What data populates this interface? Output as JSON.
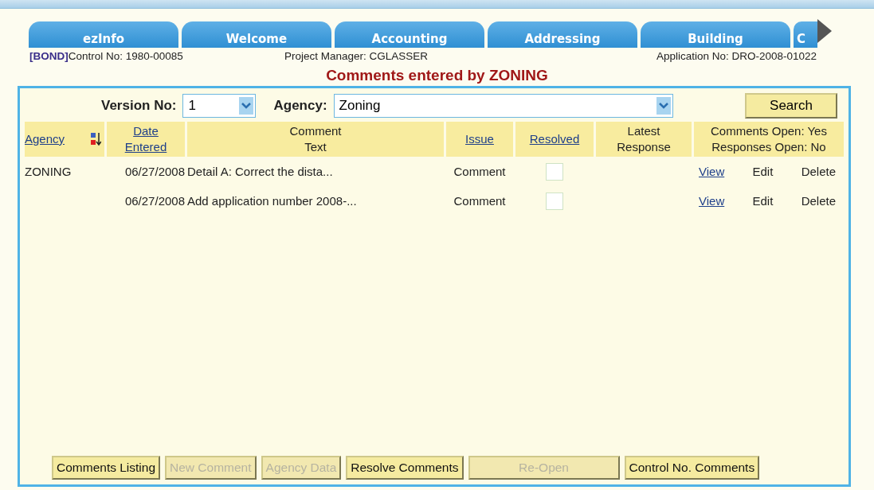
{
  "tabs": [
    {
      "label": "ezInfo",
      "selected": false
    },
    {
      "label": "Welcome",
      "selected": false
    },
    {
      "label": "Accounting",
      "selected": false
    },
    {
      "label": "Addressing",
      "selected": false
    },
    {
      "label": "Building",
      "selected": false
    },
    {
      "label": "C",
      "selected": false
    }
  ],
  "info": {
    "tag": "[BOND]",
    "control": "Control No: 1980-00085",
    "manager": "Project Manager: CGLASSER",
    "application": "Application No:  DRO-2008-01022"
  },
  "heading": "Comments entered by ZONING",
  "filters": {
    "version_label": "Version No:",
    "version": "1",
    "agency_label": "Agency:",
    "agency": "Zoning",
    "search": "Search"
  },
  "table": {
    "columns": [
      {
        "label": "Agency",
        "link": true
      },
      {
        "label": "Date Entered",
        "link": true
      },
      {
        "label": "Comment Text",
        "link": false
      },
      {
        "label": "Issue",
        "link": true
      },
      {
        "label": "Resolved",
        "link": true
      },
      {
        "label": "Latest Response",
        "link": false
      }
    ],
    "status": [
      "Comments Open: Yes",
      "Responses Open: No"
    ],
    "rows": [
      {
        "agency": "ZONING",
        "date": "06/27/2008",
        "text": "Detail A: Correct the dista...",
        "issue": "Comment",
        "resolved": false,
        "actions": [
          "View",
          "Edit",
          "Delete"
        ]
      },
      {
        "agency": "",
        "date": "06/27/2008",
        "text": "Add application number 2008-...",
        "issue": "Comment",
        "resolved": false,
        "actions": [
          "View",
          "Edit",
          "Delete"
        ]
      }
    ]
  },
  "buttons": [
    {
      "label": "Comments Listing",
      "disabled": false
    },
    {
      "label": "New Comment",
      "disabled": true
    },
    {
      "label": "Agency Data",
      "disabled": true
    },
    {
      "label": "Resolve Comments",
      "disabled": false
    },
    {
      "label": "Re-Open",
      "disabled": true
    },
    {
      "label": "Control No. Comments",
      "disabled": false
    }
  ]
}
